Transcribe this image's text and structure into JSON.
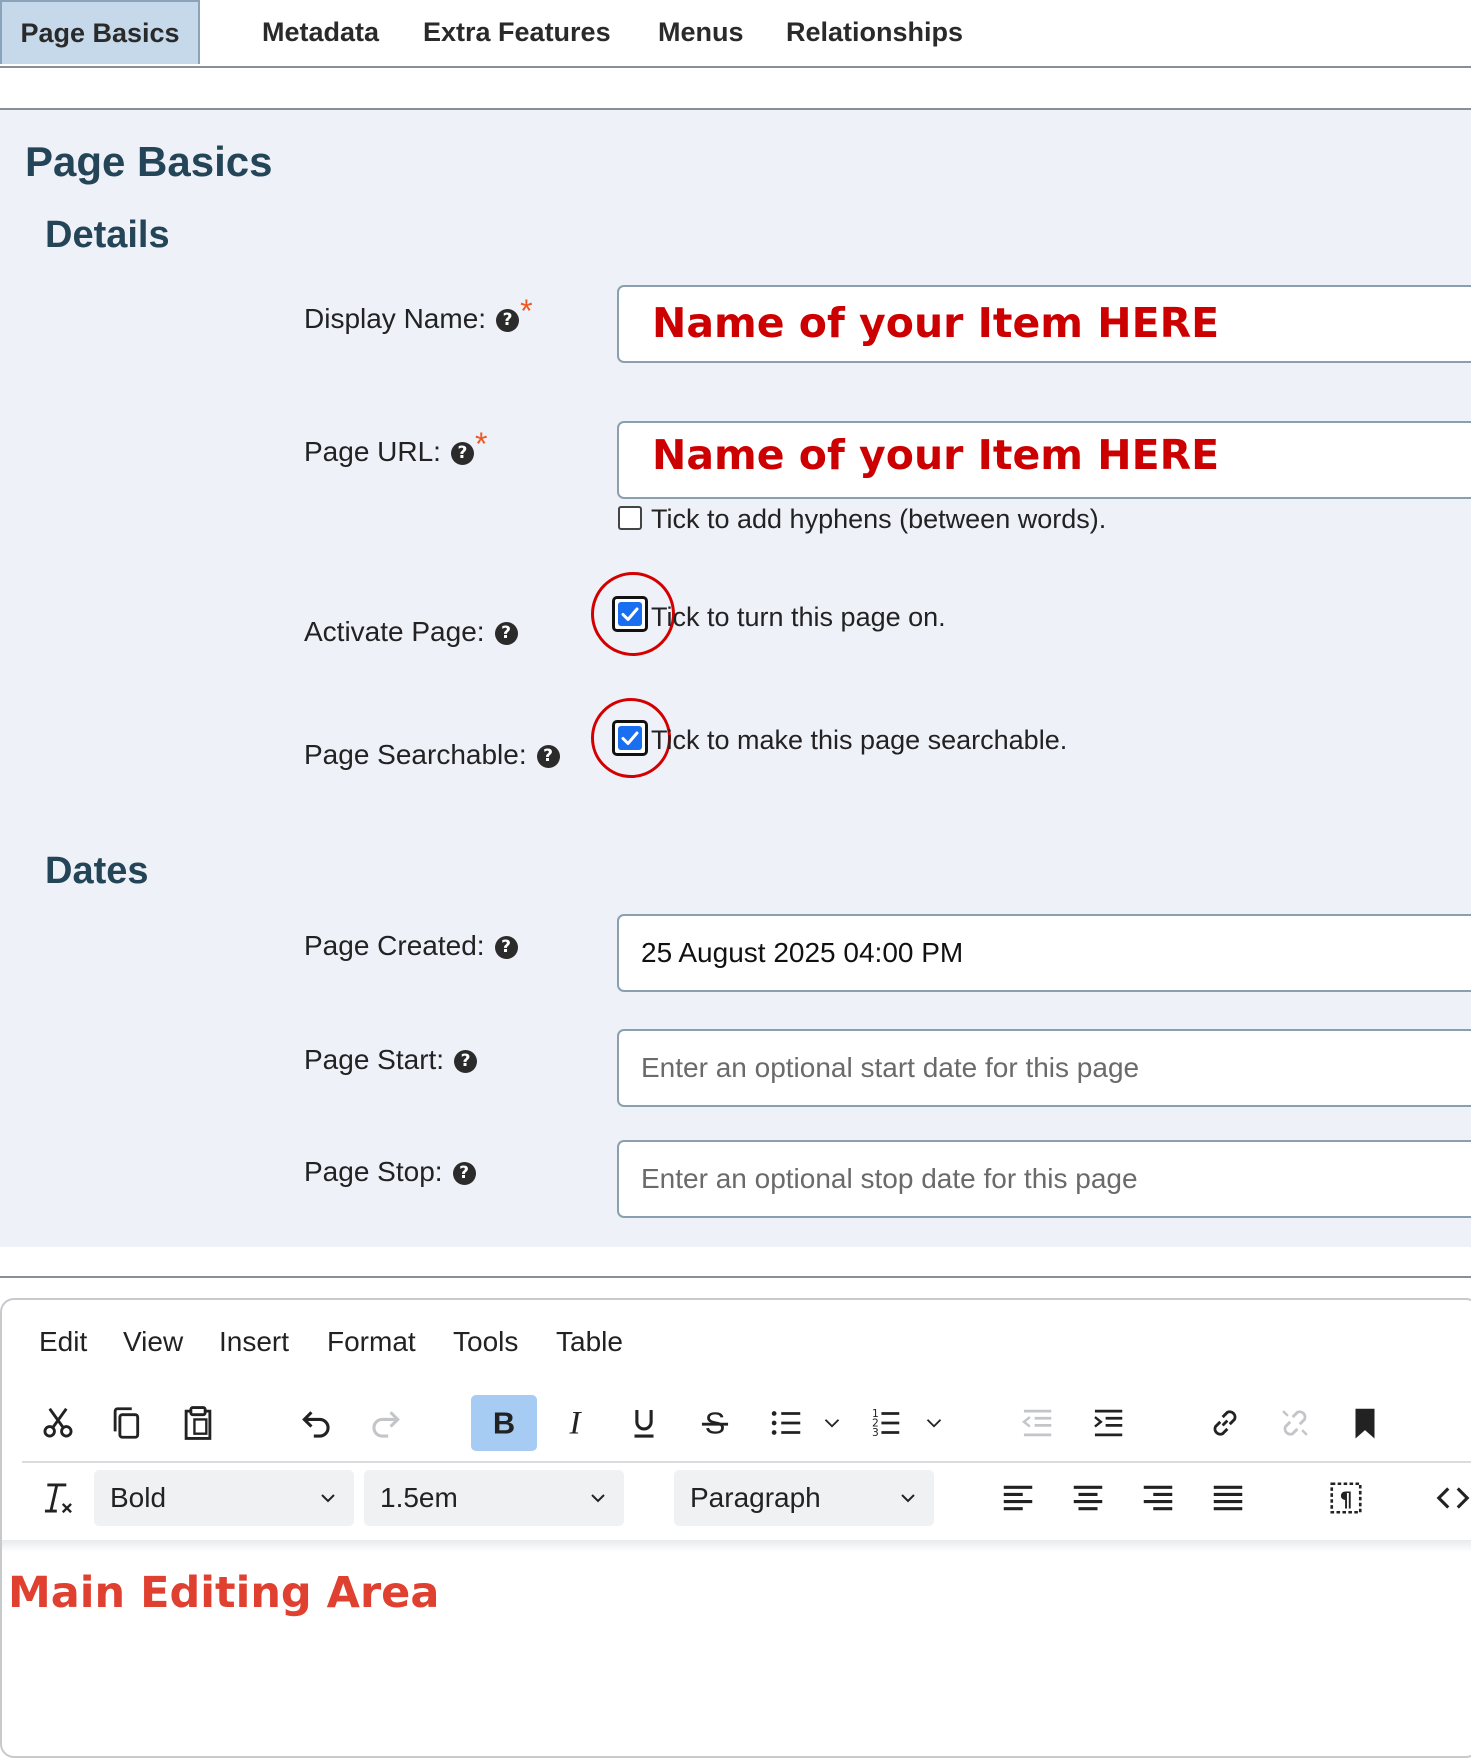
{
  "tabs": [
    "Page Basics",
    "Metadata",
    "Extra Features",
    "Menus",
    "Relationships"
  ],
  "panel": {
    "title": "Page Basics",
    "details_heading": "Details",
    "dates_heading": "Dates",
    "help_glyph": "?",
    "required_mark": "*",
    "display_name": {
      "label": "Display Name:",
      "note": "Name of your Item HERE"
    },
    "page_url": {
      "label": "Page URL:",
      "note": "Name of your Item HERE",
      "hyphen_text": "Tick to add hyphens (between words).",
      "hyphen_checked": false
    },
    "activate": {
      "label": "Activate Page:",
      "text": "Tick to turn this page on.",
      "checked": true
    },
    "searchable": {
      "label": "Page Searchable:",
      "text": "Tick to make this page searchable.",
      "checked": true
    },
    "created": {
      "label": "Page Created:",
      "value": "25 August 2025 04:00 PM"
    },
    "start": {
      "label": "Page Start:",
      "placeholder": "Enter an optional start date for this page"
    },
    "stop": {
      "label": "Page Stop:",
      "placeholder": "Enter an optional stop date for this page"
    }
  },
  "editor": {
    "menus": [
      "Edit",
      "View",
      "Insert",
      "Format",
      "Tools",
      "Table"
    ],
    "font_weight_select": "Bold",
    "font_size_select": "1.5em",
    "block_select": "Paragraph",
    "main_area_text": "Main Editing Area",
    "accent_color": "#a6ccf4",
    "toolbar_icons": [
      "cut-icon",
      "copy-icon",
      "paste-icon",
      "undo-icon",
      "redo-icon",
      "bold-icon",
      "italic-icon",
      "underline-icon",
      "strikethrough-icon",
      "bullet-list-icon",
      "numbered-list-icon",
      "outdent-icon",
      "indent-icon",
      "link-icon",
      "unlink-icon",
      "bookmark-icon",
      "clear-format-icon",
      "align-left-icon",
      "align-center-icon",
      "align-right-icon",
      "justify-icon",
      "show-blocks-icon",
      "code-icon"
    ]
  },
  "colors": {
    "heading": "#244557",
    "panel_bg": "#eff1f9",
    "note_red": "#cc0000",
    "main_area_red": "#e0402f",
    "required_orange": "#f0581e",
    "checkbox_blue": "#1a6ff0",
    "highlight_ring": "#d30000"
  }
}
